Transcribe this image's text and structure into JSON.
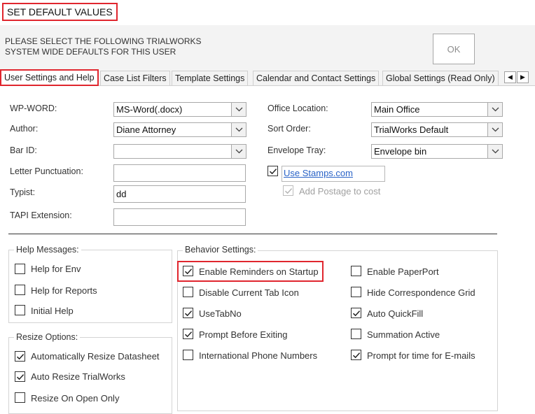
{
  "title": "SET DEFAULT VALUES",
  "instructions": {
    "line1": "PLEASE SELECT THE FOLLOWING TRIALWORKS",
    "line2": "SYSTEM WIDE DEFAULTS FOR THIS USER"
  },
  "ok_label": "OK",
  "tabs": [
    {
      "label": "User Settings and Help"
    },
    {
      "label": "Case List Filters"
    },
    {
      "label": "Template Settings"
    },
    {
      "label": "Calendar and Contact Settings"
    },
    {
      "label": "Global Settings (Read Only)"
    }
  ],
  "tab_scroll": {
    "left": "◀",
    "right": "▶"
  },
  "fields": {
    "wp_word": {
      "label": "WP-WORD:",
      "value": "MS-Word(.docx)"
    },
    "author": {
      "label": "Author:",
      "value": "Diane Attorney"
    },
    "bar_id": {
      "label": "Bar ID:",
      "value": ""
    },
    "letter_punctuation": {
      "label": "Letter Punctuation:",
      "value": ""
    },
    "typist": {
      "label": "Typist:",
      "value": "dd"
    },
    "tapi_extension": {
      "label": "TAPI Extension:",
      "value": ""
    },
    "office_location": {
      "label": "Office Location:",
      "value": "Main Office"
    },
    "sort_order": {
      "label": "Sort Order:",
      "value": "TrialWorks Default"
    },
    "envelope_tray": {
      "label": "Envelope Tray:",
      "value": "Envelope bin"
    }
  },
  "stamps": {
    "use_stamps_label": "Use Stamps.com",
    "use_stamps_checked": true,
    "add_postage_label": "Add Postage to cost",
    "add_postage_checked": true
  },
  "help_messages": {
    "title": "Help Messages:",
    "items": [
      {
        "label": "Help for Env",
        "checked": false
      },
      {
        "label": "Help for Reports",
        "checked": false
      },
      {
        "label": "Initial Help",
        "checked": false
      }
    ]
  },
  "resize_options": {
    "title": "Resize Options:",
    "items": [
      {
        "label": "Automatically Resize Datasheet",
        "checked": true
      },
      {
        "label": "Auto Resize TrialWorks",
        "checked": true
      },
      {
        "label": "Resize On Open Only",
        "checked": false
      }
    ]
  },
  "behavior": {
    "title": "Behavior Settings:",
    "left": [
      {
        "label": "Enable Reminders on Startup",
        "checked": true
      },
      {
        "label": "Disable Current Tab Icon",
        "checked": false
      },
      {
        "label": "UseTabNo",
        "checked": true
      },
      {
        "label": "Prompt Before Exiting",
        "checked": true
      },
      {
        "label": "International Phone Numbers",
        "checked": false
      }
    ],
    "right": [
      {
        "label": "Enable PaperPort",
        "checked": false
      },
      {
        "label": "Hide Correspondence Grid",
        "checked": false
      },
      {
        "label": "Auto QuickFill",
        "checked": true
      },
      {
        "label": "Summation Active",
        "checked": false
      },
      {
        "label": "Prompt for time for E-mails",
        "checked": true
      }
    ]
  },
  "colors": {
    "highlight": "#e0262e",
    "link": "#2a63c7",
    "header_bg": "#f3f3f3"
  }
}
